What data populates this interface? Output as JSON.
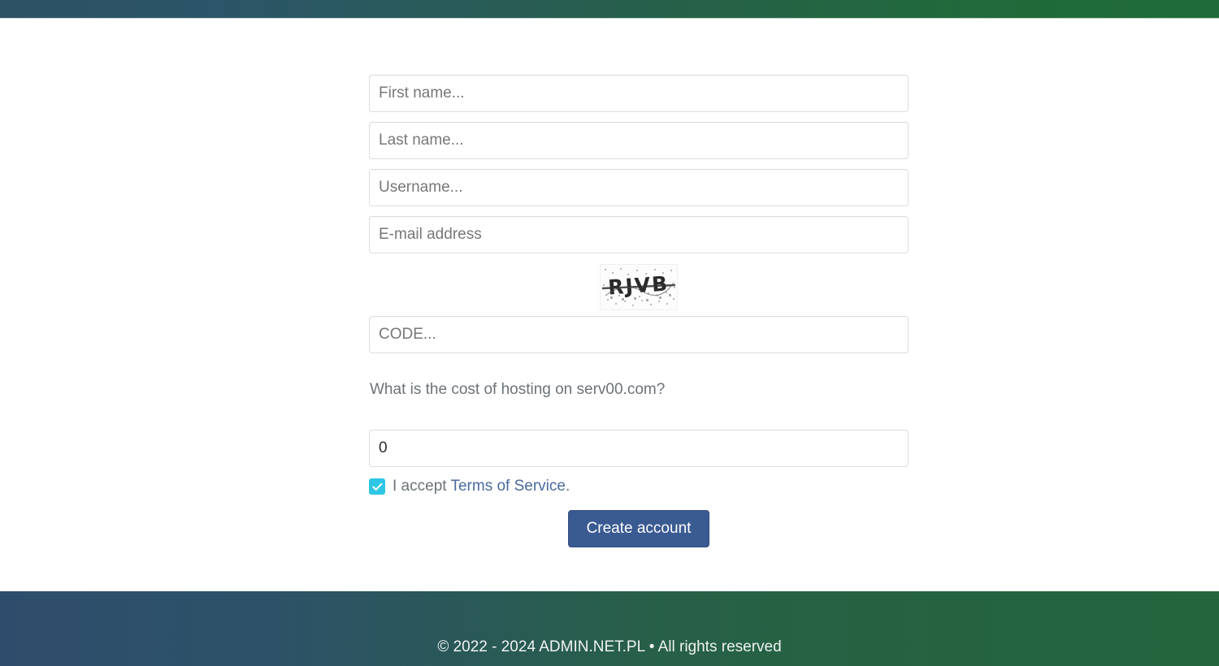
{
  "theme": {
    "topbar_gradient_start": "#2d5165",
    "topbar_gradient_end": "#1f6c38",
    "footer_gradient_start": "#2e4d6c",
    "footer_gradient_end": "#24653e",
    "accent_button": "#3a5a92",
    "checkbox_checked": "#2ec6e4",
    "link_color": "#4a6a9d",
    "placeholder_color": "#777777",
    "field_border": "#dddddd",
    "page_background": "#ffffff"
  },
  "form": {
    "first_name": {
      "placeholder": "First name...",
      "value": ""
    },
    "last_name": {
      "placeholder": "Last name...",
      "value": ""
    },
    "username": {
      "placeholder": "Username...",
      "value": ""
    },
    "email": {
      "placeholder": "E-mail address",
      "value": ""
    },
    "captcha_code": {
      "placeholder": "CODE...",
      "value": ""
    },
    "captcha_image": {
      "icon": "captcha-image",
      "text": "RJVB",
      "description": "distorted noisy captcha characters with strikethrough line"
    },
    "question": {
      "label": "What is the cost of hosting on serv00.com?",
      "answer_value": "0",
      "answer_placeholder": ""
    },
    "terms": {
      "checked": true,
      "checkmark_icon": "check-icon",
      "prefix": "I accept ",
      "link_label": "Terms of Service",
      "suffix": "."
    },
    "submit_label": "Create account"
  },
  "footer": {
    "copyright": "© 2022 - 2024 ADMIN.NET.PL • All rights reserved"
  }
}
